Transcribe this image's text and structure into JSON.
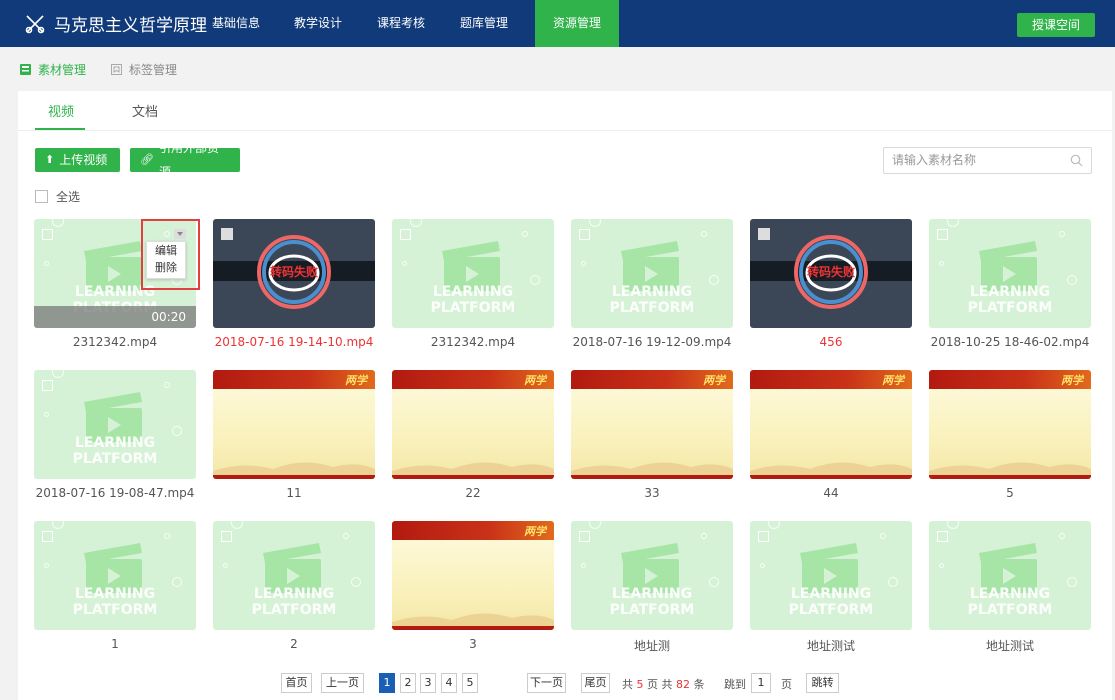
{
  "app": {
    "title": "马克思主义哲学原理"
  },
  "nav": [
    {
      "label": "基础信息"
    },
    {
      "label": "教学设计"
    },
    {
      "label": "课程考核"
    },
    {
      "label": "题库管理"
    },
    {
      "label": "资源管理",
      "active": true
    }
  ],
  "space_button": "授课空间",
  "subtabs": [
    {
      "label": "素材管理",
      "active": true
    },
    {
      "label": "标签管理"
    }
  ],
  "tabs": [
    {
      "label": "视频",
      "active": true
    },
    {
      "label": "文档"
    }
  ],
  "toolbar": {
    "upload_label": "上传视频",
    "external_label": "引用外部资源",
    "search_placeholder": "请输入素材名称",
    "select_all": "全选"
  },
  "context_menu": {
    "edit": "编辑",
    "delete": "删除"
  },
  "items": [
    {
      "name": "2312342.mp4",
      "kind": "video",
      "duration": "00:20"
    },
    {
      "name": "2018-07-16 19-14-10.mp4",
      "kind": "failed",
      "status": "转码失败"
    },
    {
      "name": "2312342.mp4",
      "kind": "video"
    },
    {
      "name": "2018-07-16 19-12-09.mp4",
      "kind": "video"
    },
    {
      "name": "456",
      "kind": "failed",
      "status": "转码失败"
    },
    {
      "name": "2018-10-25 18-46-02.mp4",
      "kind": "video"
    },
    {
      "name": "2018-07-16 19-08-47.mp4",
      "kind": "video"
    },
    {
      "name": "11",
      "kind": "doc"
    },
    {
      "name": "22",
      "kind": "doc"
    },
    {
      "name": "33",
      "kind": "doc"
    },
    {
      "name": "44",
      "kind": "doc"
    },
    {
      "name": "5",
      "kind": "doc"
    },
    {
      "name": "1",
      "kind": "video"
    },
    {
      "name": "2",
      "kind": "video"
    },
    {
      "name": "3",
      "kind": "doc"
    },
    {
      "name": "地址测",
      "kind": "video"
    },
    {
      "name": "地址测试",
      "kind": "video"
    },
    {
      "name": "地址测试",
      "kind": "video"
    }
  ],
  "watermark": "LEARNING PLATFORM",
  "doc_banner": "两学",
  "pagination": {
    "first": "首页",
    "prev": "上一页",
    "pages": [
      "1",
      "2",
      "3",
      "4",
      "5"
    ],
    "current": "1",
    "next": "下一页",
    "last": "尾页",
    "total_pages_prefix": "共",
    "total_pages": "5",
    "total_pages_suffix": "页 共",
    "total_items": "82",
    "total_items_suffix": "条",
    "jump_prefix": "跳到",
    "jump_value": "1",
    "jump_suffix": "页",
    "jump_button": "跳转"
  },
  "colors": {
    "nav_bg": "#103a7a",
    "accent": "#2fb34a",
    "error": "#e33333",
    "page_active": "#1a5fb4"
  }
}
